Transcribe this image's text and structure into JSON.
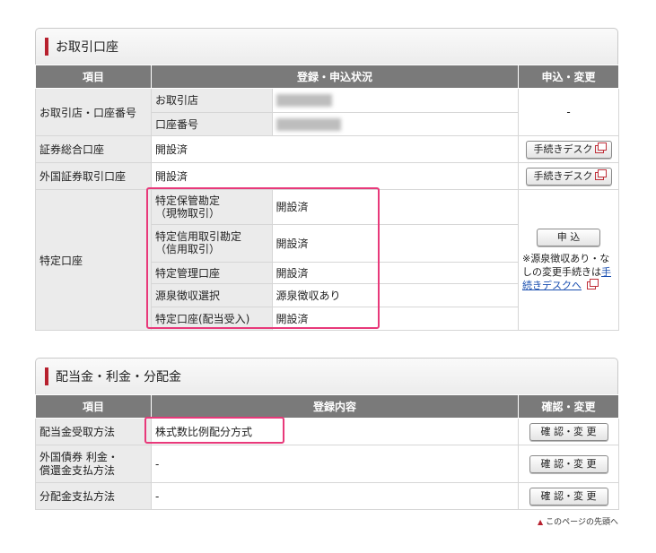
{
  "account": {
    "title": "お取引口座",
    "headers": [
      "項目",
      "登録・申込状況",
      "申込・変更"
    ],
    "branch_row": {
      "label": "お取引店・口座番号",
      "sub": [
        "お取引店",
        "口座番号"
      ],
      "action": "-"
    },
    "securities_row": {
      "label": "証券総合口座",
      "status": "開設済",
      "button": "手続きデスク"
    },
    "foreign_row": {
      "label": "外国証券取引口座",
      "status": "開設済",
      "button": "手続きデスク"
    },
    "specific": {
      "label": "特定口座",
      "items": [
        {
          "label": "特定保管勘定\n（現物取引）",
          "value": "開設済"
        },
        {
          "label": "特定信用取引勘定\n（信用取引）",
          "value": "開設済"
        },
        {
          "label": "特定管理口座",
          "value": "開設済"
        },
        {
          "label": "源泉徴収選択",
          "value": "源泉徴収あり"
        },
        {
          "label": "特定口座(配当受入)",
          "value": "開設済"
        }
      ],
      "apply_button": "申 込",
      "note_text": "※源泉徴収あり・なしの変更手続きは",
      "note_link": "手続きデスクへ"
    }
  },
  "dividend": {
    "title": "配当金・利金・分配金",
    "headers": [
      "項目",
      "登録内容",
      "確認・変更"
    ],
    "rows": [
      {
        "label": "配当金受取方法",
        "value": "株式数比例配分方式",
        "button": "確 認・変 更"
      },
      {
        "label": "外国債券 利金・\n償還金支払方法",
        "value": "-",
        "button": "確 認・変 更"
      },
      {
        "label": "分配金支払方法",
        "value": "-",
        "button": "確 認・変 更"
      }
    ]
  },
  "page_top": "このページの先頭へ",
  "colors": {
    "accent": "#b7202e",
    "highlight": "#e8397a",
    "header_bg": "#7a7a7a",
    "label_bg": "#ebebeb"
  }
}
